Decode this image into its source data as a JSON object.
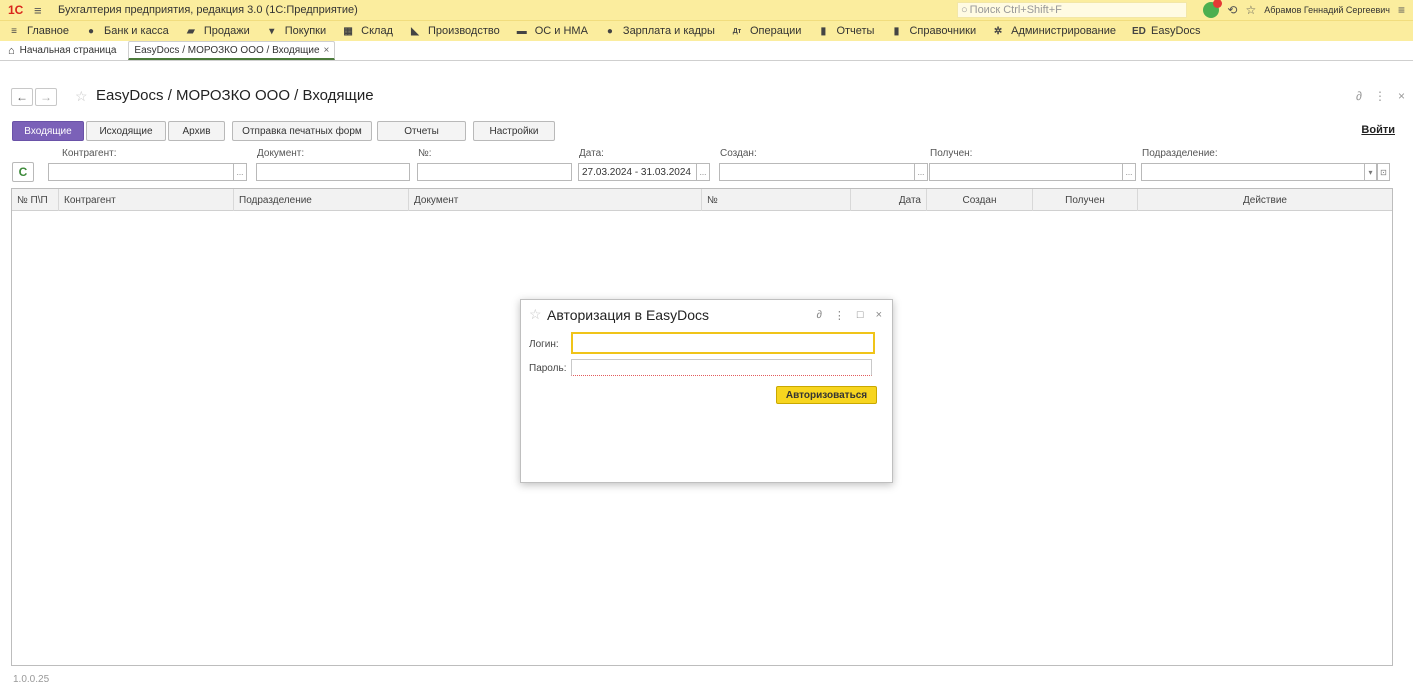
{
  "titlebar": {
    "logo": "1С",
    "app_title": "Бухгалтерия предприятия, редакция 3.0  (1С:Предприятие)",
    "search_placeholder": "Поиск Ctrl+Shift+F",
    "user": "Абрамов Геннадий Сергеевич"
  },
  "menu": [
    {
      "icon": "menu-icon",
      "label": "Главное"
    },
    {
      "icon": "ruble-icon",
      "label": "Банк и касса"
    },
    {
      "icon": "bag-icon",
      "label": "Продажи"
    },
    {
      "icon": "cart-icon",
      "label": "Покупки"
    },
    {
      "icon": "warehouse-icon",
      "label": "Склад"
    },
    {
      "icon": "factory-icon",
      "label": "Производство"
    },
    {
      "icon": "truck-icon",
      "label": "ОС и НМА"
    },
    {
      "icon": "person-icon",
      "label": "Зарплата и кадры"
    },
    {
      "icon": "dt-kt-icon",
      "label": "Операции"
    },
    {
      "icon": "chart-icon",
      "label": "Отчеты"
    },
    {
      "icon": "book-icon",
      "label": "Справочники"
    },
    {
      "icon": "gear-icon",
      "label": "Администрирование"
    },
    {
      "icon": "ed-icon",
      "label": "EasyDocs"
    }
  ],
  "tabs": {
    "home": "Начальная страница",
    "open": "EasyDocs / МОРОЗКО ООО / Входящие"
  },
  "form": {
    "title": "EasyDocs / МОРОЗКО ООО / Входящие"
  },
  "buttons": {
    "incoming": "Входящие",
    "outgoing": "Исходящие",
    "archive": "Архив",
    "print_forms": "Отправка печатных форм",
    "reports": "Отчеты",
    "settings": "Настройки",
    "login": "Войти"
  },
  "filters": {
    "counterparty": "Контрагент:",
    "document": "Документ:",
    "number": "№:",
    "date": "Дата:",
    "date_value": "27.03.2024 - 31.03.2024",
    "created": "Создан:",
    "received": "Получен:",
    "department": "Подразделение:"
  },
  "table": {
    "columns": [
      "№ П\\П",
      "Контрагент",
      "Подразделение",
      "Документ",
      "№",
      "Дата",
      "Создан",
      "Получен",
      "Действие"
    ]
  },
  "dialog": {
    "title": "Авторизация в EasyDocs",
    "login_label": "Логин:",
    "password_label": "Пароль:",
    "submit": "Авторизоваться"
  },
  "version": "1.0.0.25"
}
